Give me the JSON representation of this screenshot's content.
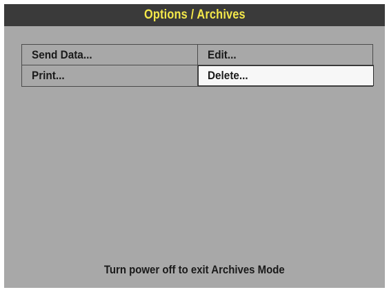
{
  "screen": {
    "title": "Options / Archives",
    "colors": {
      "title_bar_bg": "#3a3a3a",
      "title_text": "#f4e84a",
      "screen_bg": "#a8a8a8",
      "selected_bg": "#f7f7f7"
    }
  },
  "menu": {
    "items": [
      {
        "label": "Send Data...",
        "selected": false
      },
      {
        "label": "Edit...",
        "selected": false
      },
      {
        "label": "Print...",
        "selected": false
      },
      {
        "label": "Delete...",
        "selected": true
      }
    ]
  },
  "status": {
    "message": "Turn power off to exit Archives Mode"
  }
}
